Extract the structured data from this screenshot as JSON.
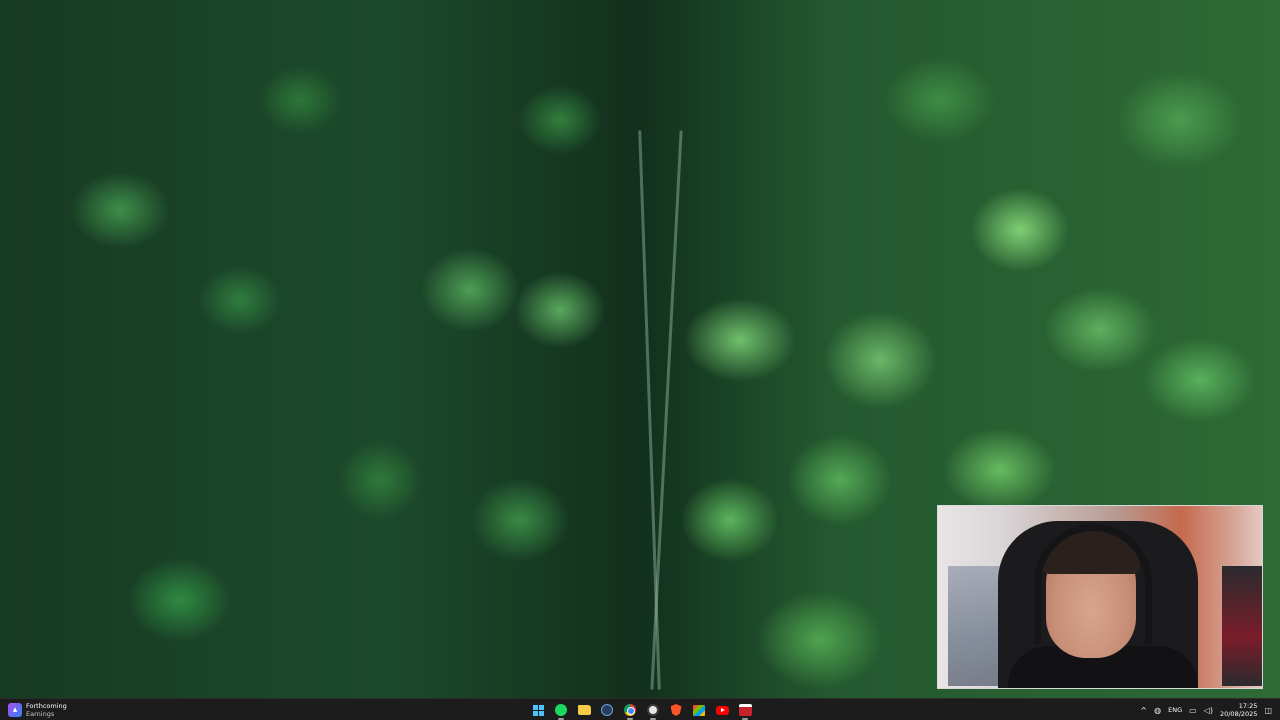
{
  "widget": {
    "title": "Forthcoming",
    "subtitle": "Earnings"
  },
  "taskbar": {
    "pinned_icons": [
      "windows-start-icon",
      "spotify-icon",
      "file-explorer-icon",
      "steam-icon",
      "chrome-icon",
      "obs-icon",
      "brave-icon",
      "microsoft-store-icon",
      "youtube-icon",
      "app-red-icon"
    ],
    "background_color": "#1c1c1c",
    "start_color": "#4cc2ff"
  },
  "tray": {
    "chevron": "^",
    "language": "ENG",
    "time": "17:25",
    "date": "20/08/2025"
  }
}
